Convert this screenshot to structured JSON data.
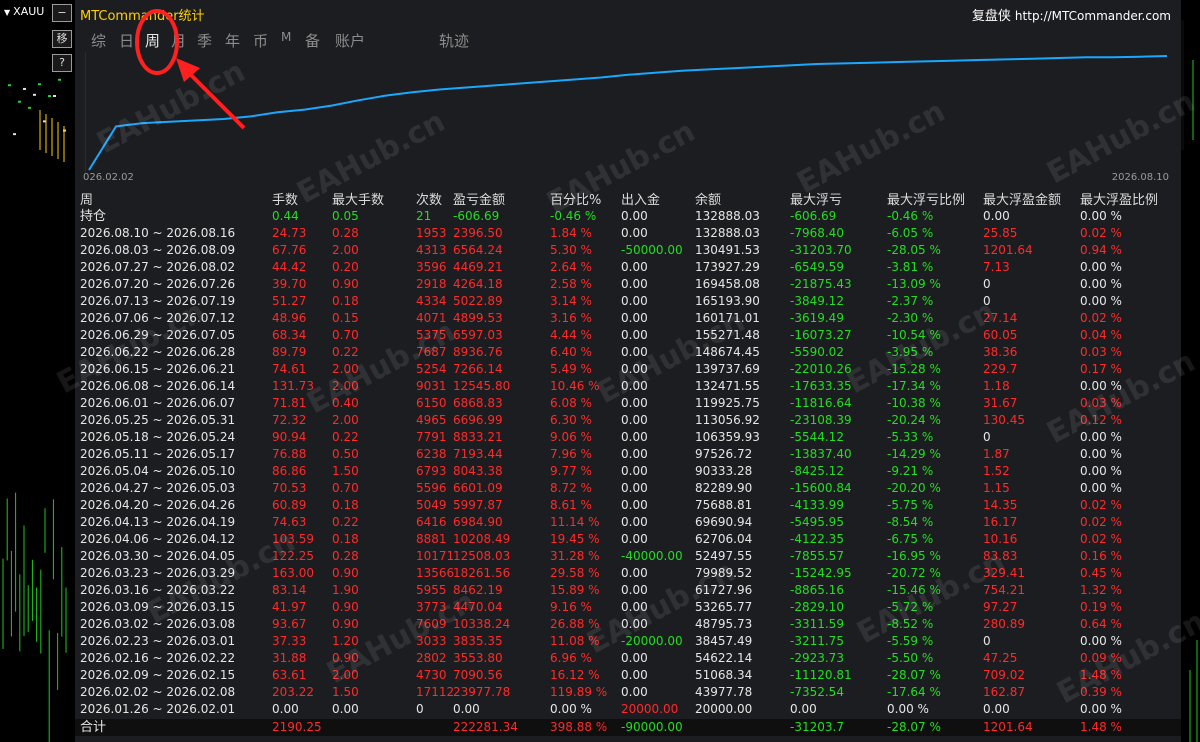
{
  "app": {
    "symbol": "XAUU",
    "title": "MTCommander统计",
    "brand": "复盘侠",
    "url": "http://MTCommander.com",
    "side_buttons": [
      "移",
      "?"
    ]
  },
  "tabs": [
    {
      "label": "综",
      "active": false
    },
    {
      "label": "日",
      "active": false
    },
    {
      "label": "周",
      "active": true
    },
    {
      "label": "月",
      "active": false
    },
    {
      "label": "季",
      "active": false
    },
    {
      "label": "年",
      "active": false
    },
    {
      "label": "币",
      "active": false
    },
    {
      "label": "M",
      "active": false
    },
    {
      "label": "备",
      "active": false
    },
    {
      "label": "账户",
      "active": false
    },
    {
      "label": "轨迹",
      "active": false
    }
  ],
  "chart_data": {
    "type": "line",
    "x_start_label": "026.02.02",
    "x_end_label": "2026.08.10",
    "color": "#1aa8ff",
    "series": [
      {
        "values": [
          0,
          65,
          70,
          72,
          74,
          76,
          80,
          86,
          90,
          96,
          104,
          111,
          116,
          120,
          123,
          126,
          129,
          132,
          135,
          138,
          142,
          145,
          148,
          150,
          152,
          154,
          156,
          158,
          159,
          160,
          161,
          162,
          163,
          164,
          165,
          166,
          167,
          168,
          168,
          169,
          170
        ]
      }
    ]
  },
  "table": {
    "headers": [
      "周",
      "手数",
      "最大手数",
      "次数",
      "盈亏金额",
      "百分比%",
      "出入金",
      "余额",
      "最大浮亏",
      "最大浮亏比例",
      "最大浮盈金额",
      "最大浮盈比例"
    ],
    "holding": {
      "label": "持仓",
      "lots": "0.44",
      "max_lots": "0.05",
      "count": "21",
      "pnl": "-606.69",
      "pct": "-0.46 %",
      "flow": "0.00",
      "balance": "132888.03",
      "max_dd": "-606.69",
      "max_dd_pct": "-0.46 %",
      "max_fp": "0.00",
      "max_fp_pct": "0.00 %"
    },
    "rows": [
      {
        "period": "2026.08.10 ~ 2026.08.16",
        "lots": "24.73",
        "max_lots": "0.28",
        "count": "1953",
        "pnl": "2396.50",
        "pct": "1.84 %",
        "flow": "0.00",
        "balance": "132888.03",
        "max_dd": "-7968.40",
        "max_dd_pct": "-6.05 %",
        "max_fp": "25.85",
        "max_fp_pct": "0.02 %"
      },
      {
        "period": "2026.08.03 ~ 2026.08.09",
        "lots": "67.76",
        "max_lots": "2.00",
        "count": "4313",
        "pnl": "6564.24",
        "pct": "5.30 %",
        "flow": "-50000.00",
        "balance": "130491.53",
        "max_dd": "-31203.70",
        "max_dd_pct": "-28.05 %",
        "max_fp": "1201.64",
        "max_fp_pct": "0.94 %"
      },
      {
        "period": "2026.07.27 ~ 2026.08.02",
        "lots": "44.42",
        "max_lots": "0.20",
        "count": "3596",
        "pnl": "4469.21",
        "pct": "2.64 %",
        "flow": "0.00",
        "balance": "173927.29",
        "max_dd": "-6549.59",
        "max_dd_pct": "-3.81 %",
        "max_fp": "7.13",
        "max_fp_pct": "0.00 %"
      },
      {
        "period": "2026.07.20 ~ 2026.07.26",
        "lots": "39.70",
        "max_lots": "0.90",
        "count": "2918",
        "pnl": "4264.18",
        "pct": "2.58 %",
        "flow": "0.00",
        "balance": "169458.08",
        "max_dd": "-21875.43",
        "max_dd_pct": "-13.09 %",
        "max_fp": "0",
        "max_fp_pct": "0.00 %"
      },
      {
        "period": "2026.07.13 ~ 2026.07.19",
        "lots": "51.27",
        "max_lots": "0.18",
        "count": "4334",
        "pnl": "5022.89",
        "pct": "3.14 %",
        "flow": "0.00",
        "balance": "165193.90",
        "max_dd": "-3849.12",
        "max_dd_pct": "-2.37 %",
        "max_fp": "0",
        "max_fp_pct": "0.00 %"
      },
      {
        "period": "2026.07.06 ~ 2026.07.12",
        "lots": "48.96",
        "max_lots": "0.15",
        "count": "4071",
        "pnl": "4899.53",
        "pct": "3.16 %",
        "flow": "0.00",
        "balance": "160171.01",
        "max_dd": "-3619.49",
        "max_dd_pct": "-2.30 %",
        "max_fp": "27.14",
        "max_fp_pct": "0.02 %"
      },
      {
        "period": "2026.06.29 ~ 2026.07.05",
        "lots": "68.34",
        "max_lots": "0.70",
        "count": "5375",
        "pnl": "6597.03",
        "pct": "4.44 %",
        "flow": "0.00",
        "balance": "155271.48",
        "max_dd": "-16073.27",
        "max_dd_pct": "-10.54 %",
        "max_fp": "60.05",
        "max_fp_pct": "0.04 %"
      },
      {
        "period": "2026.06.22 ~ 2026.06.28",
        "lots": "89.79",
        "max_lots": "0.22",
        "count": "7687",
        "pnl": "8936.76",
        "pct": "6.40 %",
        "flow": "0.00",
        "balance": "148674.45",
        "max_dd": "-5590.02",
        "max_dd_pct": "-3.95 %",
        "max_fp": "38.36",
        "max_fp_pct": "0.03 %"
      },
      {
        "period": "2026.06.15 ~ 2026.06.21",
        "lots": "74.61",
        "max_lots": "2.00",
        "count": "5254",
        "pnl": "7266.14",
        "pct": "5.49 %",
        "flow": "0.00",
        "balance": "139737.69",
        "max_dd": "-22010.26",
        "max_dd_pct": "-15.28 %",
        "max_fp": "229.7",
        "max_fp_pct": "0.17 %"
      },
      {
        "period": "2026.06.08 ~ 2026.06.14",
        "lots": "131.73",
        "max_lots": "2.00",
        "count": "9031",
        "pnl": "12545.80",
        "pct": "10.46 %",
        "flow": "0.00",
        "balance": "132471.55",
        "max_dd": "-17633.35",
        "max_dd_pct": "-17.34 %",
        "max_fp": "1.18",
        "max_fp_pct": "0.00 %"
      },
      {
        "period": "2026.06.01 ~ 2026.06.07",
        "lots": "71.81",
        "max_lots": "0.40",
        "count": "6150",
        "pnl": "6868.83",
        "pct": "6.08 %",
        "flow": "0.00",
        "balance": "119925.75",
        "max_dd": "-11816.64",
        "max_dd_pct": "-10.38 %",
        "max_fp": "31.67",
        "max_fp_pct": "0.03 %"
      },
      {
        "period": "2026.05.25 ~ 2026.05.31",
        "lots": "72.32",
        "max_lots": "2.00",
        "count": "4965",
        "pnl": "6696.99",
        "pct": "6.30 %",
        "flow": "0.00",
        "balance": "113056.92",
        "max_dd": "-23108.39",
        "max_dd_pct": "-20.24 %",
        "max_fp": "130.45",
        "max_fp_pct": "0.12 %"
      },
      {
        "period": "2026.05.18 ~ 2026.05.24",
        "lots": "90.94",
        "max_lots": "0.22",
        "count": "7791",
        "pnl": "8833.21",
        "pct": "9.06 %",
        "flow": "0.00",
        "balance": "106359.93",
        "max_dd": "-5544.12",
        "max_dd_pct": "-5.33 %",
        "max_fp": "0",
        "max_fp_pct": "0.00 %"
      },
      {
        "period": "2026.05.11 ~ 2026.05.17",
        "lots": "76.88",
        "max_lots": "0.50",
        "count": "6238",
        "pnl": "7193.44",
        "pct": "7.96 %",
        "flow": "0.00",
        "balance": "97526.72",
        "max_dd": "-13837.40",
        "max_dd_pct": "-14.29 %",
        "max_fp": "1.87",
        "max_fp_pct": "0.00 %"
      },
      {
        "period": "2026.05.04 ~ 2026.05.10",
        "lots": "86.86",
        "max_lots": "1.50",
        "count": "6793",
        "pnl": "8043.38",
        "pct": "9.77 %",
        "flow": "0.00",
        "balance": "90333.28",
        "max_dd": "-8425.12",
        "max_dd_pct": "-9.21 %",
        "max_fp": "1.52",
        "max_fp_pct": "0.00 %"
      },
      {
        "period": "2026.04.27 ~ 2026.05.03",
        "lots": "70.53",
        "max_lots": "0.70",
        "count": "5596",
        "pnl": "6601.09",
        "pct": "8.72 %",
        "flow": "0.00",
        "balance": "82289.90",
        "max_dd": "-15600.84",
        "max_dd_pct": "-20.20 %",
        "max_fp": "1.15",
        "max_fp_pct": "0.00 %"
      },
      {
        "period": "2026.04.20 ~ 2026.04.26",
        "lots": "60.89",
        "max_lots": "0.18",
        "count": "5049",
        "pnl": "5997.87",
        "pct": "8.61 %",
        "flow": "0.00",
        "balance": "75688.81",
        "max_dd": "-4133.99",
        "max_dd_pct": "-5.75 %",
        "max_fp": "14.35",
        "max_fp_pct": "0.02 %"
      },
      {
        "period": "2026.04.13 ~ 2026.04.19",
        "lots": "74.63",
        "max_lots": "0.22",
        "count": "6416",
        "pnl": "6984.90",
        "pct": "11.14 %",
        "flow": "0.00",
        "balance": "69690.94",
        "max_dd": "-5495.95",
        "max_dd_pct": "-8.54 %",
        "max_fp": "16.17",
        "max_fp_pct": "0.02 %"
      },
      {
        "period": "2026.04.06 ~ 2026.04.12",
        "lots": "103.59",
        "max_lots": "0.18",
        "count": "8881",
        "pnl": "10208.49",
        "pct": "19.45 %",
        "flow": "0.00",
        "balance": "62706.04",
        "max_dd": "-4122.35",
        "max_dd_pct": "-6.75 %",
        "max_fp": "10.16",
        "max_fp_pct": "0.02 %"
      },
      {
        "period": "2026.03.30 ~ 2026.04.05",
        "lots": "122.25",
        "max_lots": "0.28",
        "count": "10171",
        "pnl": "12508.03",
        "pct": "31.28 %",
        "flow": "-40000.00",
        "balance": "52497.55",
        "max_dd": "-7855.57",
        "max_dd_pct": "-16.95 %",
        "max_fp": "83.83",
        "max_fp_pct": "0.16 %"
      },
      {
        "period": "2026.03.23 ~ 2026.03.29",
        "lots": "163.00",
        "max_lots": "0.90",
        "count": "13566",
        "pnl": "18261.56",
        "pct": "29.58 %",
        "flow": "0.00",
        "balance": "79989.52",
        "max_dd": "-15242.95",
        "max_dd_pct": "-20.72 %",
        "max_fp": "329.41",
        "max_fp_pct": "0.45 %"
      },
      {
        "period": "2026.03.16 ~ 2026.03.22",
        "lots": "83.14",
        "max_lots": "1.90",
        "count": "5955",
        "pnl": "8462.19",
        "pct": "15.89 %",
        "flow": "0.00",
        "balance": "61727.96",
        "max_dd": "-8865.16",
        "max_dd_pct": "-15.46 %",
        "max_fp": "754.21",
        "max_fp_pct": "1.32 %"
      },
      {
        "period": "2026.03.09 ~ 2026.03.15",
        "lots": "41.97",
        "max_lots": "0.90",
        "count": "3773",
        "pnl": "4470.04",
        "pct": "9.16 %",
        "flow": "0.00",
        "balance": "53265.77",
        "max_dd": "-2829.10",
        "max_dd_pct": "-5.72 %",
        "max_fp": "97.27",
        "max_fp_pct": "0.19 %"
      },
      {
        "period": "2026.03.02 ~ 2026.03.08",
        "lots": "93.67",
        "max_lots": "0.90",
        "count": "7609",
        "pnl": "10338.24",
        "pct": "26.88 %",
        "flow": "0.00",
        "balance": "48795.73",
        "max_dd": "-3311.59",
        "max_dd_pct": "-8.52 %",
        "max_fp": "280.89",
        "max_fp_pct": "0.64 %"
      },
      {
        "period": "2026.02.23 ~ 2026.03.01",
        "lots": "37.33",
        "max_lots": "1.20",
        "count": "3033",
        "pnl": "3835.35",
        "pct": "11.08 %",
        "flow": "-20000.00",
        "balance": "38457.49",
        "max_dd": "-3211.75",
        "max_dd_pct": "-5.59 %",
        "max_fp": "0",
        "max_fp_pct": "0.00 %"
      },
      {
        "period": "2026.02.16 ~ 2026.02.22",
        "lots": "31.88",
        "max_lots": "0.90",
        "count": "2802",
        "pnl": "3553.80",
        "pct": "6.96 %",
        "flow": "0.00",
        "balance": "54622.14",
        "max_dd": "-2923.73",
        "max_dd_pct": "-5.50 %",
        "max_fp": "47.25",
        "max_fp_pct": "0.09 %"
      },
      {
        "period": "2026.02.09 ~ 2026.02.15",
        "lots": "63.61",
        "max_lots": "2.00",
        "count": "4730",
        "pnl": "7090.56",
        "pct": "16.12 %",
        "flow": "0.00",
        "balance": "51068.34",
        "max_dd": "-11120.81",
        "max_dd_pct": "-28.07 %",
        "max_fp": "709.02",
        "max_fp_pct": "1.48 %"
      },
      {
        "period": "2026.02.02 ~ 2026.02.08",
        "lots": "203.22",
        "max_lots": "1.50",
        "count": "17112",
        "pnl": "23977.78",
        "pct": "119.89 %",
        "flow": "0.00",
        "balance": "43977.78",
        "max_dd": "-7352.54",
        "max_dd_pct": "-17.64 %",
        "max_fp": "162.87",
        "max_fp_pct": "0.39 %"
      },
      {
        "period": "2026.01.26 ~ 2026.02.01",
        "lots": "0.00",
        "max_lots": "0.00",
        "count": "0",
        "pnl": "0.00",
        "pct": "0.00 %",
        "flow": "20000.00",
        "balance": "20000.00",
        "max_dd": "0.00",
        "max_dd_pct": "0.00 %",
        "max_fp": "0.00",
        "max_fp_pct": "0.00 %"
      }
    ],
    "total": {
      "label": "合计",
      "lots": "2190.25",
      "pnl": "222281.34",
      "pct": "398.88 %",
      "flow": "-90000.00",
      "max_dd": "-31203.7",
      "max_dd_pct": "-28.07 %",
      "max_fp": "1201.64",
      "max_fp_pct": "1.48 %"
    }
  },
  "watermark": "EAHub.cn",
  "colors": {
    "positive": "#ff2a2a",
    "negative": "#22dd22",
    "title": "#ffd000",
    "line": "#1aa8ff",
    "annotation": "#ff2020"
  }
}
